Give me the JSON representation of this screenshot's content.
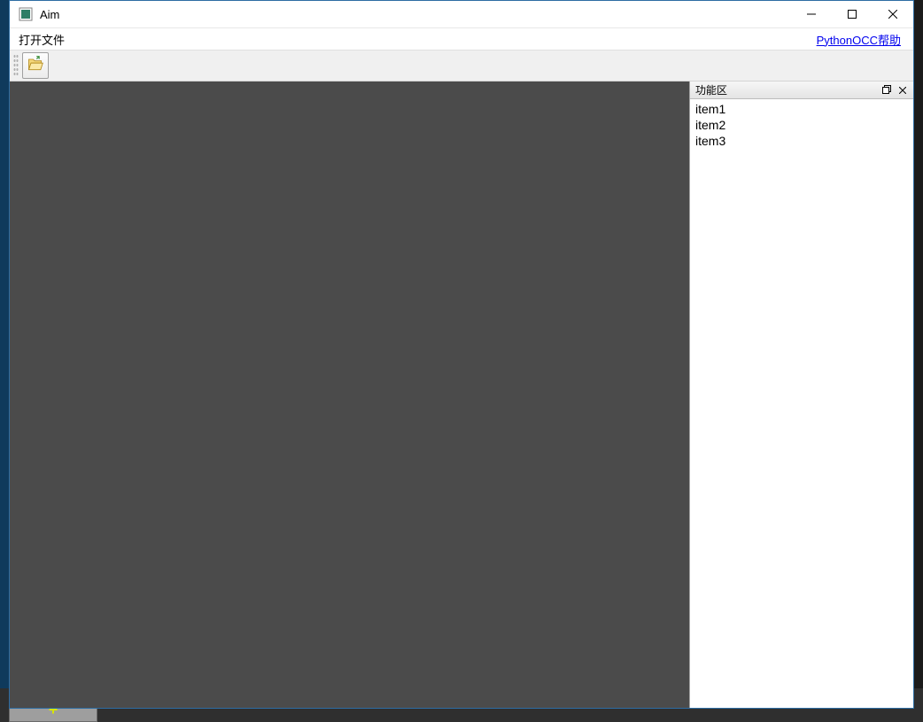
{
  "window": {
    "title": "Aim"
  },
  "menubar": {
    "open_file": "打开文件",
    "help_link": "PythonOCC帮助"
  },
  "toolbar": {
    "open_tooltip": "打开文件"
  },
  "dock": {
    "title": "功能区",
    "items": [
      "item1",
      "item2",
      "item3"
    ]
  },
  "taskbar": {
    "glyph": "+"
  }
}
